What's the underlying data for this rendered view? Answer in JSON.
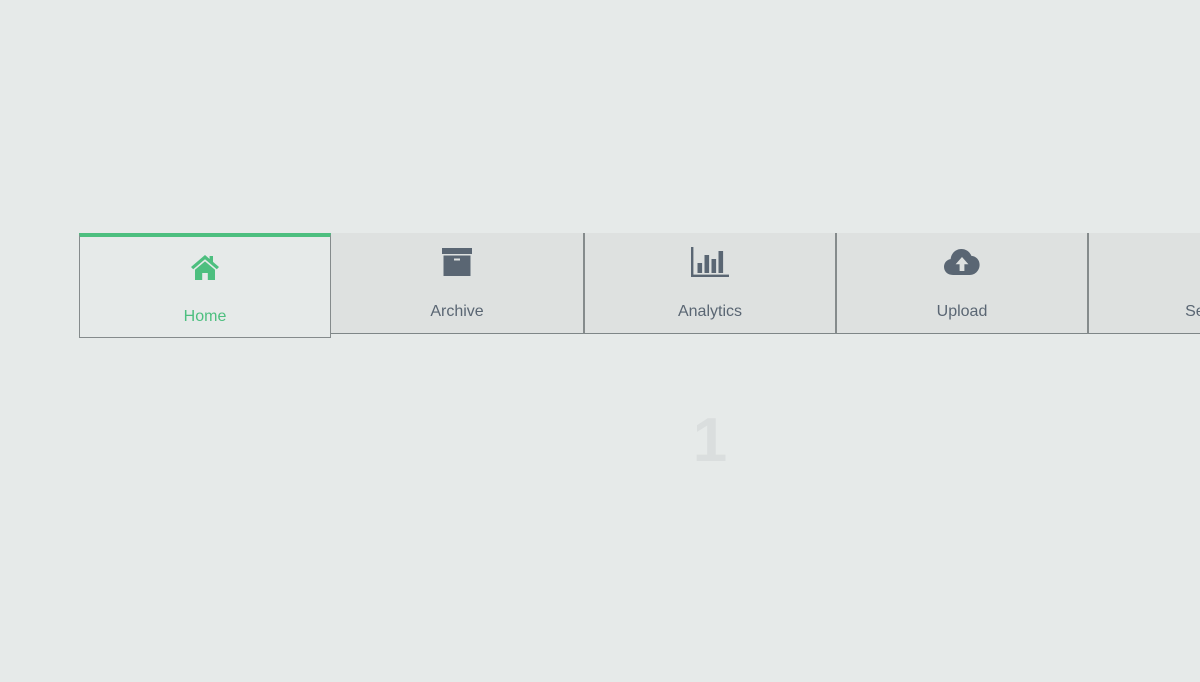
{
  "tabs": [
    {
      "label": "Home",
      "icon": "home-icon",
      "active": true
    },
    {
      "label": "Archive",
      "icon": "archive-icon",
      "active": false
    },
    {
      "label": "Analytics",
      "icon": "bar-chart-icon",
      "active": false
    },
    {
      "label": "Upload",
      "icon": "cloud-upload-icon",
      "active": false
    },
    {
      "label": "Settings",
      "icon": "gear-icon",
      "active": false
    }
  ],
  "content": {
    "panel_number": "1"
  },
  "colors": {
    "background": "#e6eae9",
    "tab_background": "#dee1e0",
    "accent": "#4dbf7f",
    "icon": "#5a6673",
    "border": "#858b8c"
  }
}
